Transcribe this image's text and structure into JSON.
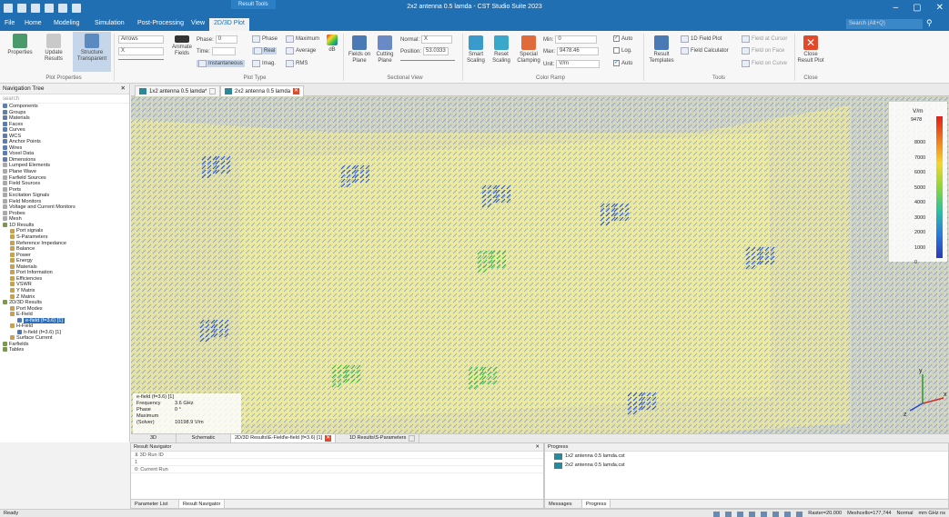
{
  "titlebar": {
    "context_tab": "Result Tools",
    "title": "2x2 antenna 0.5 lamda - CST Studio Suite 2023",
    "minimize": "–",
    "maximize": "▢",
    "close": "✕"
  },
  "ribbon_tabs": {
    "file": "File",
    "home": "Home",
    "modeling": "Modeling",
    "simulation": "Simulation",
    "post_processing": "Post-Processing",
    "view": "View",
    "plot": "2D/3D Plot",
    "search_placeholder": "Search (Alt+Q)"
  },
  "ribbon": {
    "properties": "Properties",
    "update_results": "Update Results",
    "structure_transparent": "Structure Transparent",
    "plot_properties_group": "Plot Properties",
    "arrows": "Arrows",
    "arrows_value": "X",
    "phase_label": "Phase:",
    "phase_value": "0",
    "time_label": "Time:",
    "animate_fields": "Animate Fields",
    "instantaneous": "Instantaneous",
    "phase_btn": "Phase",
    "real": "Real",
    "imag": "Imag.",
    "maximum": "Maximum",
    "average": "Average",
    "rms": "RMS",
    "db": "dB",
    "plot_type_group": "Plot Type",
    "fields_on_plane": "Fields on Plane",
    "cutting_plane": "Cutting Plane",
    "normal_label": "Normal:",
    "normal_value": "X",
    "position_label": "Position:",
    "position_value": "53.0333",
    "sectional_view_group": "Sectional View",
    "smart_scaling": "Smart Scaling",
    "reset_scaling": "Reset Scaling",
    "special_clamping": "Special Clamping",
    "min_label": "Min:",
    "min_value": "0",
    "max_label": "Max:",
    "max_value": "9478.46",
    "unit_label": "Unit:",
    "unit_value": "V/m",
    "auto1": "Auto",
    "log": "Log.",
    "auto2": "Auto",
    "color_ramp_group": "Color Ramp",
    "result_templates": "Result Templates",
    "field_1d_plot": "1D Field Plot",
    "field_calculator": "Field Calculator",
    "field_at_cursor": "Field at Cursor",
    "field_on_face": "Field on Face",
    "field_on_curve": "Field on Curve",
    "tools_group": "Tools",
    "close_result_plot": "Close Result Plot",
    "close_group": "Close"
  },
  "navtree": {
    "title": "Navigation Tree",
    "search": "search",
    "items": [
      {
        "label": "Components",
        "indent": 0,
        "color": "#5a7fb5"
      },
      {
        "label": "Groups",
        "indent": 0,
        "color": "#5a7fb5"
      },
      {
        "label": "Materials",
        "indent": 0,
        "color": "#5a7fb5"
      },
      {
        "label": "Faces",
        "indent": 0,
        "color": "#5a7fb5"
      },
      {
        "label": "Curves",
        "indent": 0,
        "color": "#5a7fb5"
      },
      {
        "label": "WCS",
        "indent": 0,
        "color": "#5a7fb5"
      },
      {
        "label": "Anchor Points",
        "indent": 0,
        "color": "#5a7fb5"
      },
      {
        "label": "Wires",
        "indent": 0,
        "color": "#5a7fb5"
      },
      {
        "label": "Voxel Data",
        "indent": 0,
        "color": "#5a7fb5"
      },
      {
        "label": "Dimensions",
        "indent": 0,
        "color": "#5a7fb5"
      },
      {
        "label": "Lumped Elements",
        "indent": 0,
        "color": "#aaa"
      },
      {
        "label": "Plane Wave",
        "indent": 0,
        "color": "#aaa"
      },
      {
        "label": "Farfield Sources",
        "indent": 0,
        "color": "#aaa"
      },
      {
        "label": "Field Sources",
        "indent": 0,
        "color": "#aaa"
      },
      {
        "label": "Ports",
        "indent": 0,
        "color": "#aaa"
      },
      {
        "label": "Excitation Signals",
        "indent": 0,
        "color": "#aaa"
      },
      {
        "label": "Field Monitors",
        "indent": 0,
        "color": "#aaa"
      },
      {
        "label": "Voltage and Current Monitors",
        "indent": 0,
        "color": "#aaa"
      },
      {
        "label": "Probes",
        "indent": 0,
        "color": "#aaa"
      },
      {
        "label": "Mesh",
        "indent": 0,
        "color": "#aaa"
      },
      {
        "label": "1D Results",
        "indent": 0,
        "color": "#7a9a4a"
      },
      {
        "label": "Port signals",
        "indent": 1,
        "color": "#c8a24a"
      },
      {
        "label": "S-Parameters",
        "indent": 1,
        "color": "#c8a24a"
      },
      {
        "label": "Reference Impedance",
        "indent": 1,
        "color": "#c8a24a"
      },
      {
        "label": "Balance",
        "indent": 1,
        "color": "#c8a24a"
      },
      {
        "label": "Power",
        "indent": 1,
        "color": "#c8a24a"
      },
      {
        "label": "Energy",
        "indent": 1,
        "color": "#c8a24a"
      },
      {
        "label": "Materials",
        "indent": 1,
        "color": "#c8a24a"
      },
      {
        "label": "Port Information",
        "indent": 1,
        "color": "#c8a24a"
      },
      {
        "label": "Efficiencies",
        "indent": 1,
        "color": "#c8a24a"
      },
      {
        "label": "VSWR",
        "indent": 1,
        "color": "#c8a24a"
      },
      {
        "label": "Y Matrix",
        "indent": 1,
        "color": "#c8a24a"
      },
      {
        "label": "Z Matrix",
        "indent": 1,
        "color": "#c8a24a"
      },
      {
        "label": "2D/3D Results",
        "indent": 0,
        "color": "#7a9a4a"
      },
      {
        "label": "Port Modes",
        "indent": 1,
        "color": "#c8a24a"
      },
      {
        "label": "E-Field",
        "indent": 1,
        "color": "#c8a24a"
      },
      {
        "label": "e-field (f=3.6) [1]",
        "indent": 2,
        "color": "#4a7ab5",
        "selected": true
      },
      {
        "label": "H-Field",
        "indent": 1,
        "color": "#c8a24a"
      },
      {
        "label": "h-field (f=3.6) [1]",
        "indent": 2,
        "color": "#4a7ab5"
      },
      {
        "label": "Surface Current",
        "indent": 1,
        "color": "#c8a24a"
      },
      {
        "label": "Farfields",
        "indent": 0,
        "color": "#7a9a4a"
      },
      {
        "label": "Tables",
        "indent": 0,
        "color": "#7a9a4a"
      }
    ]
  },
  "doctabs": [
    {
      "label": "1x2 antenna 0.5 lamda*",
      "active": false
    },
    {
      "label": "2x2 antenna 0.5 lamda",
      "active": true
    }
  ],
  "legend": {
    "unit": "V/m",
    "max": "9478",
    "ticks": [
      "8000",
      "7000",
      "6000",
      "5000",
      "4000",
      "3000",
      "2000",
      "1000",
      "0"
    ]
  },
  "infobox": {
    "title": "e-field (f=3.6) [1]",
    "frequency_label": "Frequency",
    "frequency_value": "3.6 GHz",
    "phase_label": "Phase",
    "phase_value": "0 °",
    "maximum_label": "Maximum (Solver)",
    "maximum_value": "10198.9 V/m"
  },
  "bottom_tabs": [
    {
      "label": "3D"
    },
    {
      "label": "Schematic"
    },
    {
      "label": "2D/3D Results\\E-Field\\e-field (f=3.6) [1]"
    },
    {
      "label": "1D Results\\S-Parameters"
    }
  ],
  "result_navigator": {
    "title": "Result Navigator",
    "col_header": "3D Run ID",
    "row1": "1",
    "row2": "0: Current Run",
    "tab_params": "Parameter List",
    "tab_nav": "Result Navigator"
  },
  "progress": {
    "title": "Progress",
    "items": [
      "1x2 antenna 0.5 lamda.cst",
      "2x2 antenna 0.5 lamda.cst"
    ],
    "tab_messages": "Messages",
    "tab_progress": "Progress"
  },
  "statusbar": {
    "left": "Ready",
    "raster": "Raster=20.000",
    "meshcells": "Meshcells=177,744",
    "normal": "Normal",
    "units": "mm GHz ns"
  },
  "colors": {
    "accent": "#1f6fb2",
    "close_red": "#e04a2b",
    "patch_yellow": "#f2ec8a",
    "arrow_blue": "#2a5ad8",
    "arrow_green": "#3ab84a"
  },
  "axes": {
    "x": "x",
    "y": "y",
    "z": "z"
  }
}
